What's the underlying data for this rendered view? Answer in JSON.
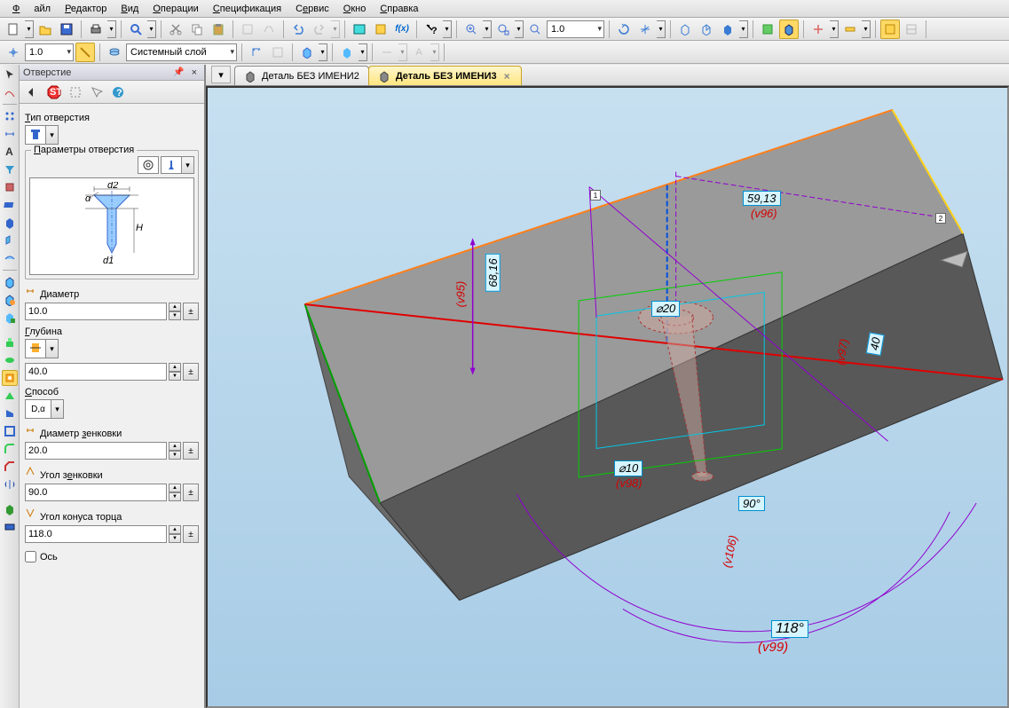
{
  "menu": [
    "Файл",
    "Редактор",
    "Вид",
    "Операции",
    "Спецификация",
    "Сервис",
    "Окно",
    "Справка"
  ],
  "toolbar1": {
    "zoom": "1.0"
  },
  "toolbar2": {
    "scale": "1.0",
    "layer": "Системный слой"
  },
  "panel": {
    "title": "Отверстие",
    "type_label": "Тип отверстия",
    "params_label": "Параметры отверстия",
    "diameter_label": "Диаметр",
    "diameter": "10.0",
    "depth_label": "Глубина",
    "depth": "40.0",
    "method_label": "Способ",
    "method": "D,α",
    "csink_d_label": "Диаметр зенковки",
    "csink_d": "20.0",
    "csink_a_label": "Угол зенковки",
    "csink_a": "90.0",
    "tip_a_label": "Угол конуса торца",
    "tip_a": "118.0",
    "axis_label": "Ось"
  },
  "tabs": [
    {
      "label": "Деталь БЕЗ ИМЕНИ2",
      "active": false
    },
    {
      "label": "Деталь БЕЗ ИМЕНИ3",
      "active": true
    }
  ],
  "dims": {
    "d1": "59,13",
    "v1": "(v96)",
    "d2": "68,16",
    "v2": "(v95)",
    "d3": "40",
    "v3": "(v97)",
    "d4": "⌀20",
    "d5": "⌀10",
    "v5": "(v98)",
    "d6": "90°",
    "v6": "(v106)",
    "d7": "118°",
    "v7": "(v99)",
    "pt1": "1",
    "pt2": "2"
  }
}
